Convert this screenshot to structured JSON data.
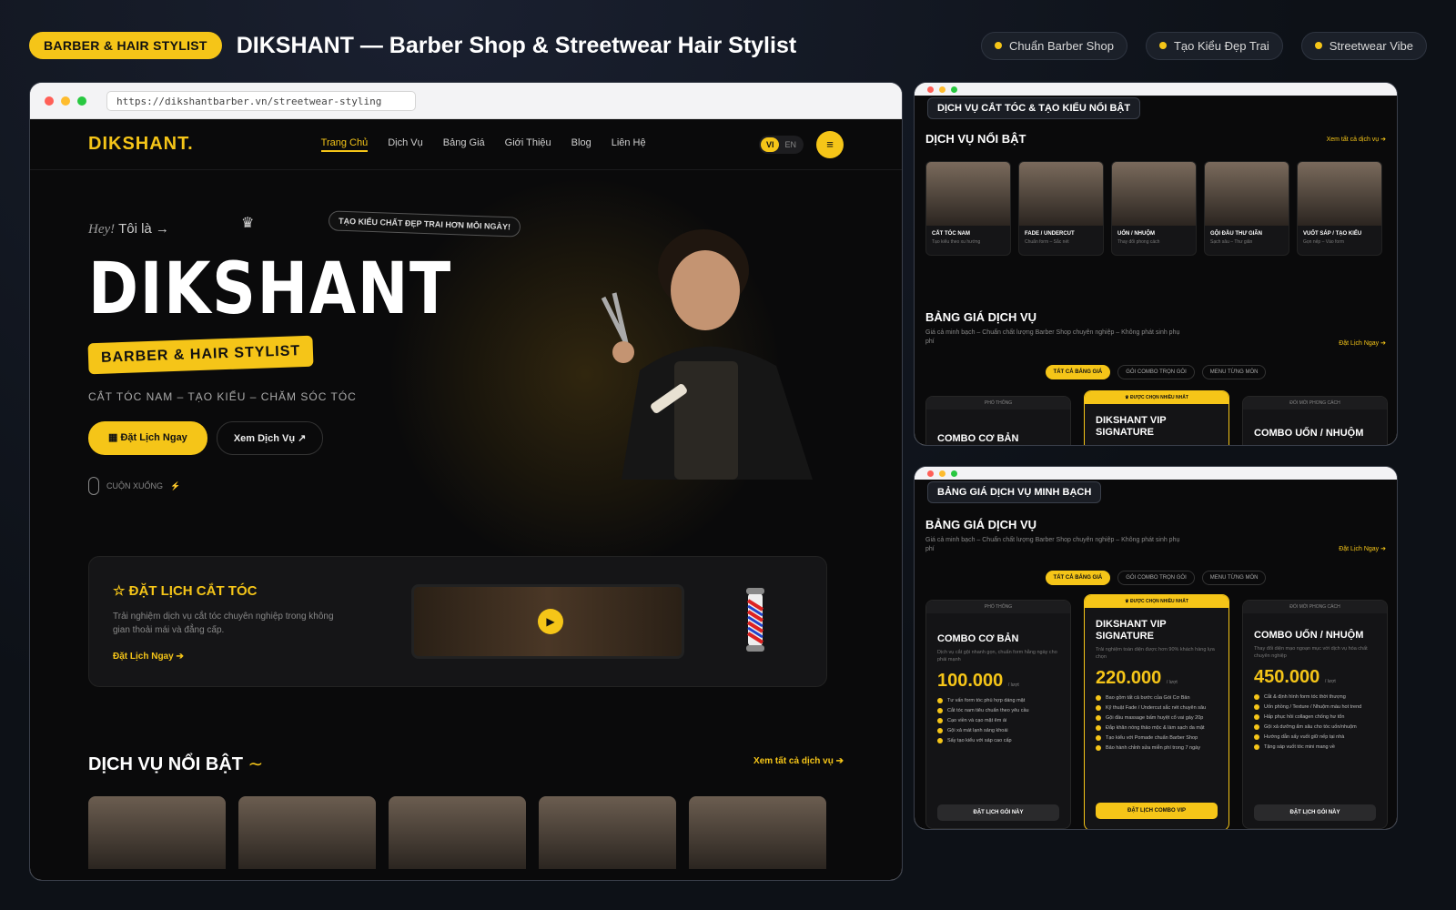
{
  "header": {
    "badge": "BARBER & HAIR STYLIST",
    "title": "DIKSHANT — Barber Shop & Streetwear Hair Stylist",
    "pills": [
      "Chuẩn Barber Shop",
      "Tạo Kiểu Đẹp Trai",
      "Streetwear Vibe"
    ]
  },
  "main_window": {
    "url": "https://dikshantbarber.vn/streetwear-styling",
    "logo": "DIKSHANT.",
    "menu": [
      "Trang Chủ",
      "Dịch Vụ",
      "Bảng Giá",
      "Giới Thiệu",
      "Blog",
      "Liên Hệ"
    ],
    "lang": [
      "VI",
      "EN"
    ],
    "hero": {
      "hey": "Hey!",
      "intro": "Tôi là",
      "name": "DIKSHANT",
      "badge": "BARBER & HAIR STYLIST",
      "tag": "TẠO KIỂU CHẤT ĐẸP TRAI HƠN MỖI NGÀY!",
      "subtitle": "CẮT TÓC NAM – TẠO KIỂU – CHĂM SÓC TÓC",
      "btn_primary": "Đặt Lịch Ngay",
      "btn_secondary": "Xem Dịch Vụ ↗",
      "scroll": "CUỘN XUỐNG"
    },
    "booking": {
      "title": "ĐẶT LỊCH CẮT TÓC",
      "text": "Trải nghiệm dịch vụ cắt tóc chuyên nghiệp trong không gian thoải mái và đẳng cấp.",
      "link": "Đặt Lịch Ngay ➔"
    },
    "services": {
      "title": "DỊCH VỤ NỔI BẬT",
      "link": "Xem tất cả dịch vụ ➔"
    }
  },
  "side1": {
    "label": "DỊCH VỤ CẮT TÓC & TẠO KIỂU NỔI BẬT",
    "services_title": "DỊCH VỤ NỔI BẬT",
    "services_link": "Xem tất cả dịch vụ ➔",
    "cards": [
      {
        "title": "CẮT TÓC NAM",
        "desc": "Tạo kiểu theo xu hướng"
      },
      {
        "title": "FADE / UNDERCUT",
        "desc": "Chuẩn form – Sắc nét"
      },
      {
        "title": "UỐN / NHUỘM",
        "desc": "Thay đổi phong cách"
      },
      {
        "title": "GỘI ĐẦU THƯ GIÃN",
        "desc": "Sạch sâu – Thư giãn"
      },
      {
        "title": "VUỐT SÁP / TẠO KIỂU",
        "desc": "Gọn nếp – Vào form"
      }
    ],
    "price_title": "BẢNG GIÁ DỊCH VỤ",
    "price_desc": "Giá cả minh bạch – Chuẩn chất lượng Barber Shop chuyên nghiệp – Không phát sinh phụ phí",
    "price_link": "Đặt Lịch Ngay ➔",
    "tabs": [
      "TẤT CẢ BẢNG GIÁ",
      "GÓI COMBO TRỌN GÓI",
      "MENU TỪNG MÓN"
    ],
    "plans": [
      {
        "top": "PHỔ THÔNG",
        "name": "COMBO CƠ BẢN"
      },
      {
        "top": "ĐƯỢC CHỌN NHIỀU NHẤT",
        "name": "DIKSHANT VIP SIGNATURE"
      },
      {
        "top": "ĐỔI MỚI PHONG CÁCH",
        "name": "COMBO UỐN / NHUỘM"
      }
    ]
  },
  "side2": {
    "label": "BẢNG GIÁ DỊCH VỤ MINH BẠCH",
    "price_title": "BẢNG GIÁ DỊCH VỤ",
    "price_desc": "Giá cả minh bạch – Chuẩn chất lượng Barber Shop chuyên nghiệp – Không phát sinh phụ phí",
    "price_link": "Đặt Lịch Ngay ➔",
    "tabs": [
      "TẤT CẢ BẢNG GIÁ",
      "GÓI COMBO TRỌN GÓI",
      "MENU TỪNG MÓN"
    ],
    "plans": [
      {
        "top": "PHỔ THÔNG",
        "name": "COMBO CƠ BẢN",
        "desc": "Dịch vụ cắt gội nhanh gọn, chuẩn form hằng ngày cho phái mạnh",
        "price": "100.000",
        "unit": "/ lượt",
        "features": [
          "Tư vấn form tóc phù hợp dáng mặt",
          "Cắt tóc nam tiêu chuẩn theo yêu cầu",
          "Cạo viền và cạo mặt êm ái",
          "Gội xả mát lạnh sảng khoái",
          "Sấy tạo kiểu với sáp cao cấp"
        ],
        "button": "ĐẶT LỊCH GÓI NÀY"
      },
      {
        "top": "ĐƯỢC CHỌN NHIỀU NHẤT",
        "name": "DIKSHANT VIP SIGNATURE",
        "desc": "Trải nghiệm toàn diện được hơn 90% khách hàng lựa chọn",
        "price": "220.000",
        "unit": "/ lượt",
        "features": [
          "Bao gồm tất cả bước của Gói Cơ Bản",
          "Kỹ thuật Fade / Undercut sắc nét chuyên sâu",
          "Gội đầu massage bấm huyệt cổ vai gáy 20p",
          "Đắp khăn nóng thảo mộc & làm sạch da mặt",
          "Tạo kiểu với Pomade chuẩn Barber Shop",
          "Bảo hành chỉnh sửa miễn phí trong 7 ngày"
        ],
        "button": "ĐẶT LỊCH COMBO VIP"
      },
      {
        "top": "ĐỔI MỚI PHONG CÁCH",
        "name": "COMBO UỐN / NHUỘM",
        "desc": "Thay đổi diện mạo ngoạn mục với dịch vụ hóa chất chuyên nghiệp",
        "price": "450.000",
        "unit": "/ lượt",
        "features": [
          "Cắt & định hình form tóc thời thượng",
          "Uốn phồng / Texture / Nhuộm màu hot trend",
          "Hấp phục hồi collagen chống hư tổn",
          "Gội xả dưỡng ẩm sâu cho tóc uốn/nhuộm",
          "Hướng dẫn sấy vuốt giữ nếp tại nhà",
          "Tặng sáp vuốt tóc mini mang về"
        ],
        "button": "ĐẶT LỊCH GÓI NÀY"
      }
    ]
  }
}
